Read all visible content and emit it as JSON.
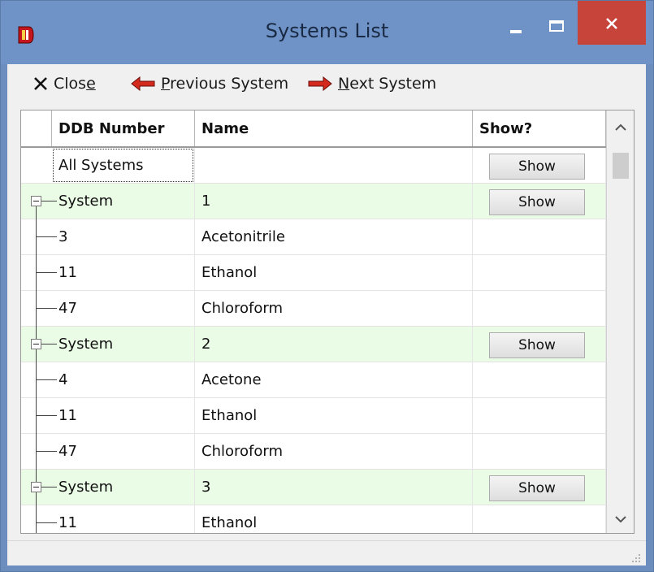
{
  "window": {
    "title": "Systems List",
    "accent": "#6f93c6",
    "close_color": "#c7443a"
  },
  "toolbar": {
    "close_label_pre": "Clos",
    "close_label_u": "e",
    "prev_label_u": "P",
    "prev_label_post": "revious System",
    "next_label_u": "N",
    "next_label_post": "ext System"
  },
  "grid": {
    "columns": [
      "DDB Number",
      "Name",
      "Show?"
    ],
    "show_label": "Show",
    "row_all": {
      "ddb": "All Systems",
      "name": ""
    },
    "systems": [
      {
        "label": "System",
        "number": "1",
        "components": [
          {
            "ddb": "3",
            "name": "Acetonitrile"
          },
          {
            "ddb": "11",
            "name": "Ethanol"
          },
          {
            "ddb": "47",
            "name": "Chloroform"
          }
        ]
      },
      {
        "label": "System",
        "number": "2",
        "components": [
          {
            "ddb": "4",
            "name": "Acetone"
          },
          {
            "ddb": "11",
            "name": "Ethanol"
          },
          {
            "ddb": "47",
            "name": "Chloroform"
          }
        ]
      },
      {
        "label": "System",
        "number": "3",
        "components": [
          {
            "ddb": "11",
            "name": "Ethanol"
          }
        ]
      }
    ]
  },
  "colors": {
    "system_row_bg": "#eafbe6",
    "arrow_red": "#d42a1e"
  }
}
